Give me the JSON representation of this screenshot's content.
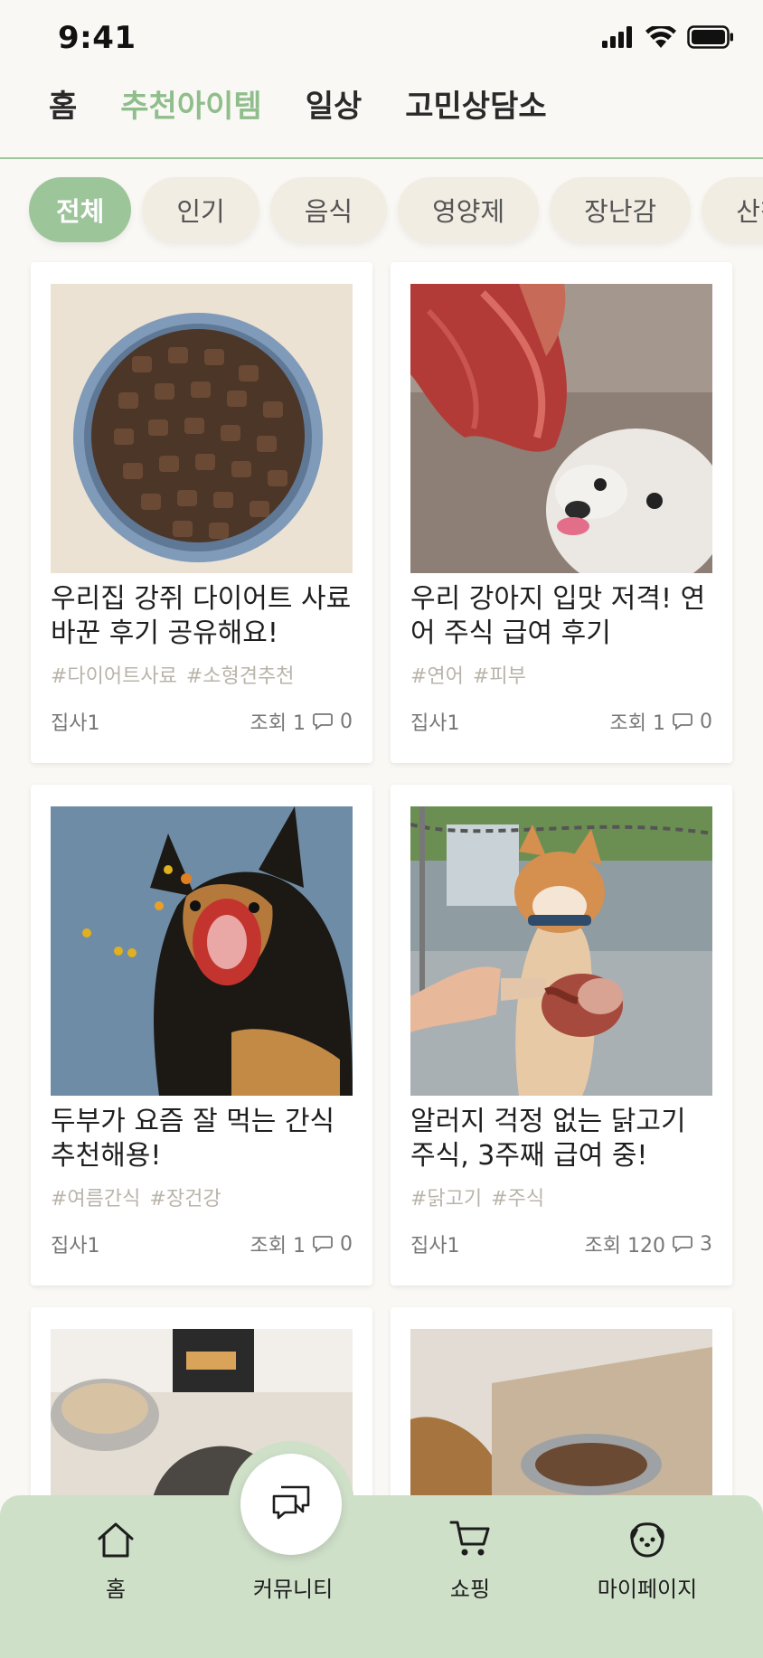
{
  "status": {
    "time": "9:41"
  },
  "top_tabs": [
    {
      "label": "홈"
    },
    {
      "label": "추천아이템",
      "active": true
    },
    {
      "label": "일상"
    },
    {
      "label": "고민상담소"
    }
  ],
  "chips": [
    {
      "label": "전체",
      "active": true
    },
    {
      "label": "인기"
    },
    {
      "label": "음식"
    },
    {
      "label": "영양제"
    },
    {
      "label": "장난감"
    },
    {
      "label": "산책용품"
    }
  ],
  "posts": [
    {
      "title": "우리집 강쥐 다이어트 사료 바꾼 후기 공유해요!",
      "tags": [
        "#다이어트사료",
        "#소형견추천"
      ],
      "author": "집사1",
      "views": "조회 1",
      "comments": "0",
      "image": "dog-food-bowl"
    },
    {
      "title": "우리 강아지 입맛 저격! 연어 주식 급여 후기",
      "tags": [
        "#연어",
        "#피부"
      ],
      "author": "집사1",
      "views": "조회 1",
      "comments": "0",
      "image": "white-dog-salmon"
    },
    {
      "title": "두부가 요즘 잘 먹는 간식 추천해용!",
      "tags": [
        "#여름간식",
        "#장건강"
      ],
      "author": "집사1",
      "views": "조회 1",
      "comments": "0",
      "image": "shepherd-catching-treats"
    },
    {
      "title": "알러지 걱정 없는 닭고기 주식, 3주째 급여 중!",
      "tags": [
        "#닭고기",
        "#주식"
      ],
      "author": "집사1",
      "views": "조회 120",
      "comments": "3",
      "image": "shiba-chicken-leg"
    },
    {
      "title": "",
      "tags": [],
      "author": "",
      "views": "",
      "comments": "",
      "image": "dog-kibble-bag"
    },
    {
      "title": "",
      "tags": [],
      "author": "",
      "views": "",
      "comments": "",
      "image": "dog-metal-bowl"
    }
  ],
  "bottom_nav": {
    "home": "홈",
    "community": "커뮤니티",
    "shopping": "쇼핑",
    "mypage": "마이페이지"
  },
  "colors": {
    "accent": "#9cc59a",
    "nav_bg": "#cfe0c9",
    "background": "#faf8f4"
  }
}
